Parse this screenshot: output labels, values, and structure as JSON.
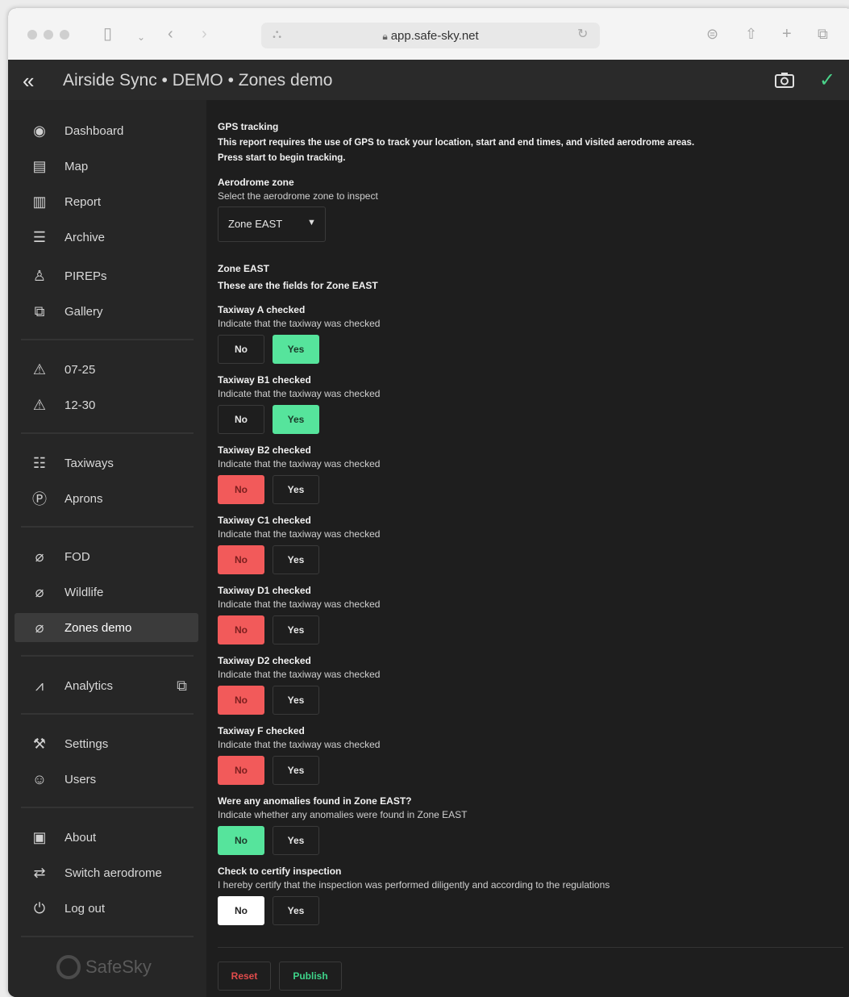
{
  "browser": {
    "url": "app.safe-sky.net"
  },
  "header": {
    "title": "Airside Sync • DEMO • Zones demo"
  },
  "sidebar": {
    "items": [
      {
        "label": "Dashboard",
        "icon": "eye-icon"
      },
      {
        "label": "Map",
        "icon": "map-icon"
      },
      {
        "label": "Report",
        "icon": "report-icon"
      },
      {
        "label": "Archive",
        "icon": "archive-icon"
      },
      {
        "label": "PIREPs",
        "icon": "pilot-icon"
      },
      {
        "label": "Gallery",
        "icon": "gallery-icon"
      },
      {
        "label": "07-25",
        "icon": "runway-warning-icon"
      },
      {
        "label": "12-30",
        "icon": "runway-warning-icon"
      },
      {
        "label": "Taxiways",
        "icon": "taxiway-icon"
      },
      {
        "label": "Aprons",
        "icon": "parking-icon"
      },
      {
        "label": "FOD",
        "icon": "paperclip-icon"
      },
      {
        "label": "Wildlife",
        "icon": "paperclip-icon"
      },
      {
        "label": "Zones demo",
        "icon": "paperclip-icon"
      },
      {
        "label": "Analytics",
        "icon": "chart-line-icon"
      },
      {
        "label": "Settings",
        "icon": "tools-icon"
      },
      {
        "label": "Users",
        "icon": "user-icon"
      },
      {
        "label": "About",
        "icon": "info-card-icon"
      },
      {
        "label": "Switch aerodrome",
        "icon": "swap-icon"
      },
      {
        "label": "Log out",
        "icon": "power-icon"
      }
    ],
    "active": "Zones demo",
    "logo_text": "SafeSky"
  },
  "form": {
    "gps": {
      "title": "GPS tracking",
      "line1": "This report requires the use of GPS to track your location, start and end times, and visited aerodrome areas.",
      "line2": "Press start to begin tracking."
    },
    "zone_select": {
      "title": "Aerodrome zone",
      "subtitle": "Select the aerodrome zone to inspect",
      "value": "Zone EAST"
    },
    "section": {
      "title": "Zone EAST",
      "subtitle": "These are the fields for Zone EAST"
    },
    "questions": [
      {
        "label": "Taxiway A checked",
        "hint": "Indicate that the taxiway was checked",
        "selected": "Yes"
      },
      {
        "label": "Taxiway B1 checked",
        "hint": "Indicate that the taxiway was checked",
        "selected": "Yes"
      },
      {
        "label": "Taxiway B2 checked",
        "hint": "Indicate that the taxiway was checked",
        "selected": "No"
      },
      {
        "label": "Taxiway C1 checked",
        "hint": "Indicate that the taxiway was checked",
        "selected": "No"
      },
      {
        "label": "Taxiway D1 checked",
        "hint": "Indicate that the taxiway was checked",
        "selected": "No"
      },
      {
        "label": "Taxiway D2 checked",
        "hint": "Indicate that the taxiway was checked",
        "selected": "No"
      },
      {
        "label": "Taxiway F checked",
        "hint": "Indicate that the taxiway was checked",
        "selected": "No"
      },
      {
        "label": "Were any anomalies found in Zone EAST?",
        "hint": "Indicate whether any anomalies were found in Zone EAST",
        "selected": "No"
      },
      {
        "label": "Check to certify inspection",
        "hint": "I hereby certify that the inspection was performed diligently and according to the regulations",
        "selected": "No"
      }
    ],
    "option_no": "No",
    "option_yes": "Yes",
    "reset_label": "Reset",
    "publish_label": "Publish"
  },
  "colors": {
    "green": "#56e49c",
    "red": "#f25a5a",
    "sidebar": "#262626",
    "main": "#1e1e1e"
  }
}
